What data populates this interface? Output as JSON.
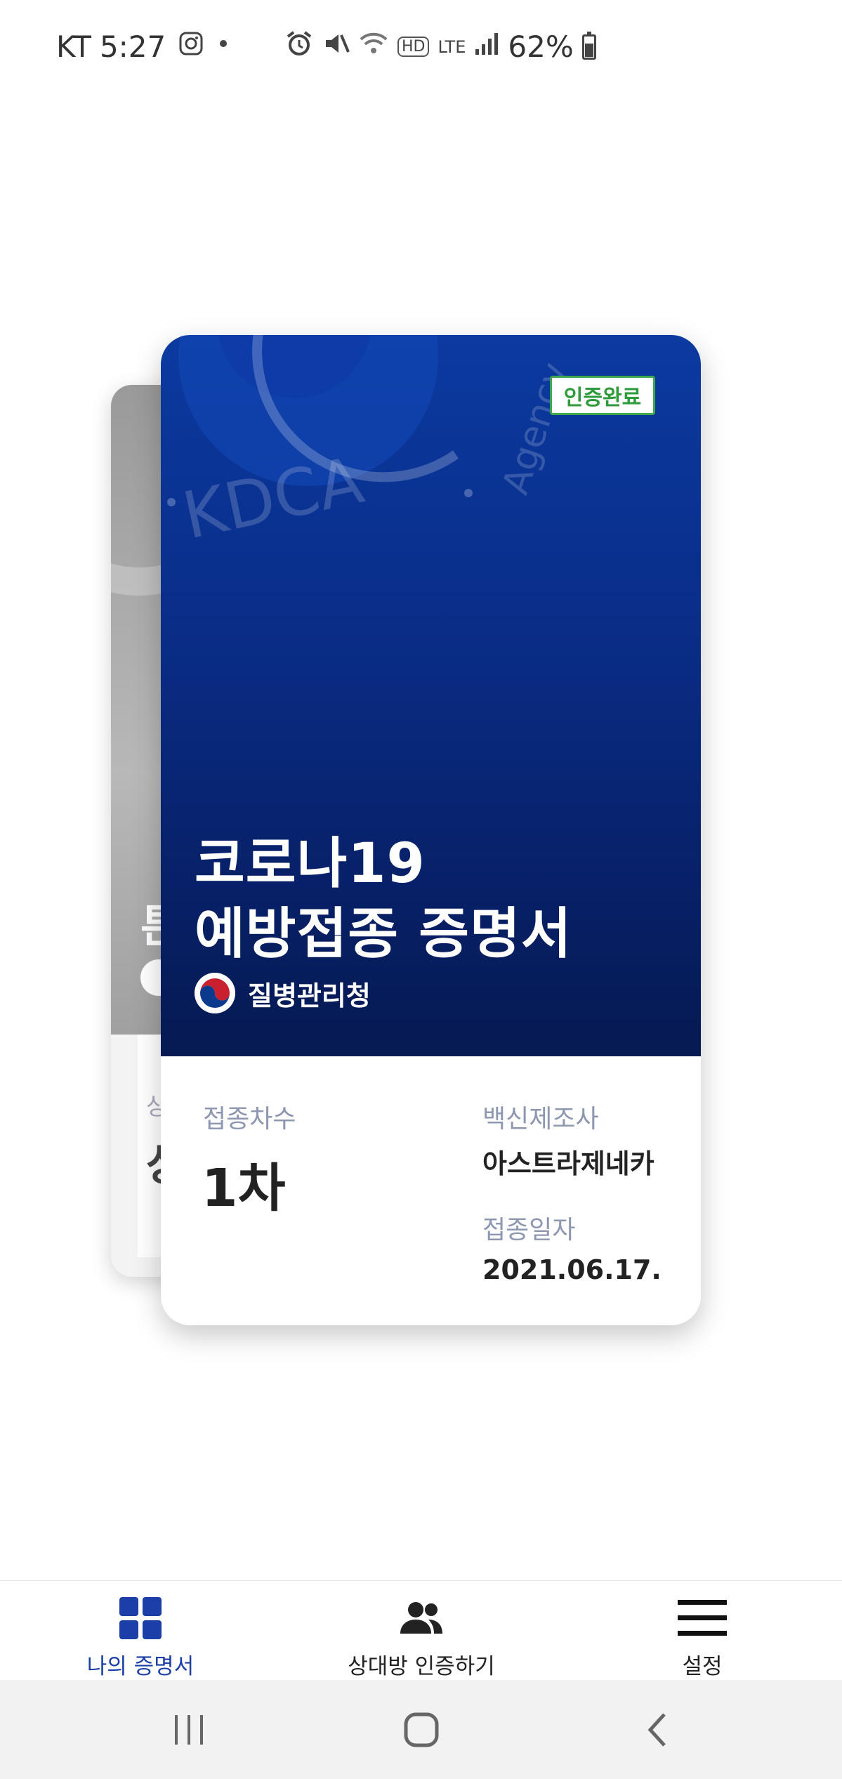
{
  "status_bar": {
    "carrier": "KT",
    "time": "5:27",
    "network_hd": "HD",
    "network_lte": "LTE",
    "battery": "62%"
  },
  "back_card": {
    "title_fragment": "튼",
    "label_fragment": "상",
    "value_fragment": "상"
  },
  "card": {
    "watermark_text": "KDCA",
    "watermark_text2": "Agency",
    "badge": "인증완료",
    "title_line1": "코로나19",
    "title_line2": "예방접종 증명서",
    "agency": "질병관리청",
    "dose_label": "접종차수",
    "dose_value": "1차",
    "maker_label": "백신제조사",
    "maker_value": "아스트라제네카",
    "date_label": "접종일자",
    "date_value": "2021.06.17."
  },
  "bottom_nav": {
    "items": [
      {
        "label": "나의 증명서",
        "icon": "grid-icon",
        "active": true
      },
      {
        "label": "상대방 인증하기",
        "icon": "people-icon",
        "active": false
      },
      {
        "label": "설정",
        "icon": "menu-icon",
        "active": false
      }
    ]
  },
  "colors": {
    "card_blue": "#0a2f8c",
    "badge_green": "#2e9b3a",
    "nav_active": "#1b3fa6"
  }
}
